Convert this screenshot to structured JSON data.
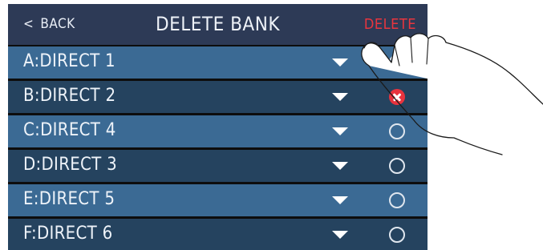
{
  "header": {
    "back_label": "BACK",
    "back_icon": "chevron-left-icon",
    "title": "DELETE BANK",
    "delete_label": "DELETE"
  },
  "colors": {
    "header_bg": "#2d3a56",
    "row_light": "#3b6a94",
    "row_dark": "#25435f",
    "delete_red": "#e8353e",
    "selected_red": "#e8333e"
  },
  "banks": [
    {
      "label": "A:DIRECT 1",
      "selected": false
    },
    {
      "label": "B:DIRECT 2",
      "selected": true
    },
    {
      "label": "C:DIRECT 4",
      "selected": false
    },
    {
      "label": "D:DIRECT 3",
      "selected": false
    },
    {
      "label": "E:DIRECT 5",
      "selected": false
    },
    {
      "label": "F:DIRECT 6",
      "selected": false
    }
  ],
  "icons": {
    "row_expand": "dropdown-arrow-icon",
    "row_unselected": "empty-circle-icon",
    "row_selected": "delete-mark-icon",
    "pointer": "tapping-hand-icon"
  }
}
